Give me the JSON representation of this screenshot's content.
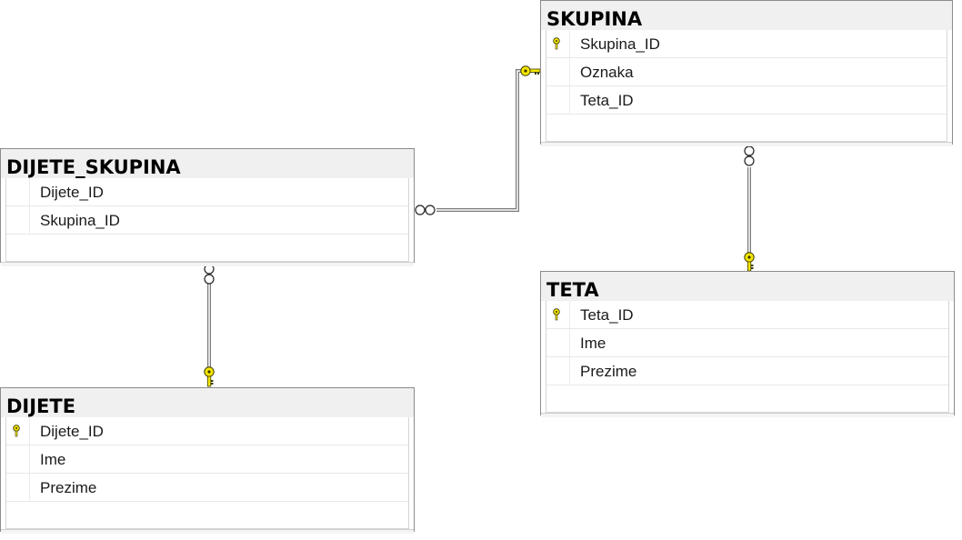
{
  "tables": {
    "dijete_skupina": {
      "title": "DIJETE_SKUPINA",
      "columns": [
        {
          "name": "Dijete_ID",
          "primary_key": false
        },
        {
          "name": "Skupina_ID",
          "primary_key": false
        }
      ]
    },
    "skupina": {
      "title": "SKUPINA",
      "columns": [
        {
          "name": "Skupina_ID",
          "primary_key": true
        },
        {
          "name": "Oznaka",
          "primary_key": false
        },
        {
          "name": "Teta_ID",
          "primary_key": false
        }
      ]
    },
    "teta": {
      "title": "TETA",
      "columns": [
        {
          "name": "Teta_ID",
          "primary_key": true
        },
        {
          "name": "Ime",
          "primary_key": false
        },
        {
          "name": "Prezime",
          "primary_key": false
        }
      ]
    },
    "dijete": {
      "title": "DIJETE",
      "columns": [
        {
          "name": "Dijete_ID",
          "primary_key": true
        },
        {
          "name": "Ime",
          "primary_key": false
        },
        {
          "name": "Prezime",
          "primary_key": false
        }
      ]
    }
  },
  "relationships": [
    {
      "from": "dijete_skupina",
      "to": "skupina",
      "from_end": "many",
      "to_end": "key"
    },
    {
      "from": "dijete_skupina",
      "to": "dijete",
      "from_end": "many",
      "to_end": "key"
    },
    {
      "from": "skupina",
      "to": "teta",
      "from_end": "many",
      "to_end": "key"
    }
  ],
  "colors": {
    "key_yellow": "#f5e600",
    "border": "#8c8c8c",
    "header_bg": "#f0f0f0"
  },
  "icons": {
    "primary_key": "key-icon",
    "many_end": "infinity-icon"
  }
}
